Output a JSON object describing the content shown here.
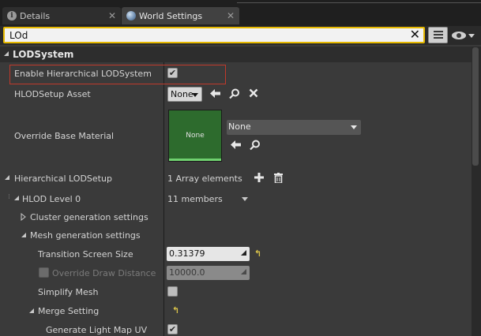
{
  "tabs": [
    {
      "label": "Details",
      "icon": "info-icon",
      "active": false
    },
    {
      "label": "World Settings",
      "icon": "globe-icon",
      "active": true
    }
  ],
  "search": {
    "value": "LOd"
  },
  "section": {
    "title": "LODSystem"
  },
  "rows": {
    "enable_hlod": {
      "label": "Enable Hierarchical LODSystem",
      "checked": true
    },
    "hlod_setup_asset": {
      "label": "HLODSetup Asset",
      "value": "None"
    },
    "override_base_material": {
      "label": "Override Base Material",
      "thumb_label": "None",
      "value": "None"
    },
    "hierarchical_lod_setup": {
      "label": "Hierarchical LODSetup",
      "value": "1 Array elements"
    },
    "hlod_level_0": {
      "label": "HLOD Level 0",
      "value": "11 members"
    },
    "cluster_generation": {
      "label": "Cluster generation settings"
    },
    "mesh_generation": {
      "label": "Mesh generation settings"
    },
    "transition_screen_size": {
      "label": "Transition Screen Size",
      "value": "0.31379"
    },
    "override_draw_distance": {
      "label": "Override Draw Distance",
      "value": "10000.0",
      "checked": false
    },
    "simplify_mesh": {
      "label": "Simplify Mesh",
      "checked": false
    },
    "merge_setting": {
      "label": "Merge Setting"
    },
    "generate_light_map_uv": {
      "label": "Generate Light Map UV",
      "checked": true
    }
  },
  "colors": {
    "search_border": "#e5b800",
    "highlight": "#c0392b",
    "thumb": "#2d6b2d",
    "reset_arrow": "#d8c24a"
  }
}
